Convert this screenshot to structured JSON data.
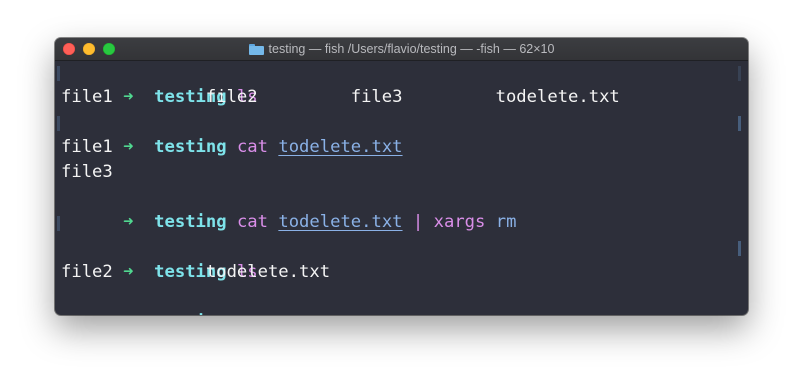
{
  "window": {
    "title": "testing — fish /Users/flavio/testing — -fish — 62×10"
  },
  "icons": {
    "folder": "folder-icon",
    "prompt": "arrow-right-icon"
  },
  "terminal": {
    "prompt_arrow": "➜",
    "prompt_dir": "testing",
    "lines": [
      {
        "cmd": "ls"
      },
      {
        "output": "file1         file2         file3         todelete.txt"
      },
      {
        "cmd": "cat",
        "arg": "todelete.txt"
      },
      {
        "output": "file1"
      },
      {
        "output": "file3"
      },
      {
        "cmd": "cat",
        "arg": "todelete.txt",
        "pipe": "|",
        "cmd2": "xargs",
        "cmd2_arg": "rm"
      },
      {
        "output": ""
      },
      {
        "cmd": "ls"
      },
      {
        "output": "file2         todelete.txt"
      },
      {
        "cmd": ""
      }
    ]
  },
  "colors": {
    "background": "#2d2f3a",
    "prompt_arrow": "#50d890",
    "prompt_dir": "#7ee3ea",
    "command": "#d98ee8",
    "argument": "#8ab1e6",
    "text": "#f4f4f4"
  }
}
